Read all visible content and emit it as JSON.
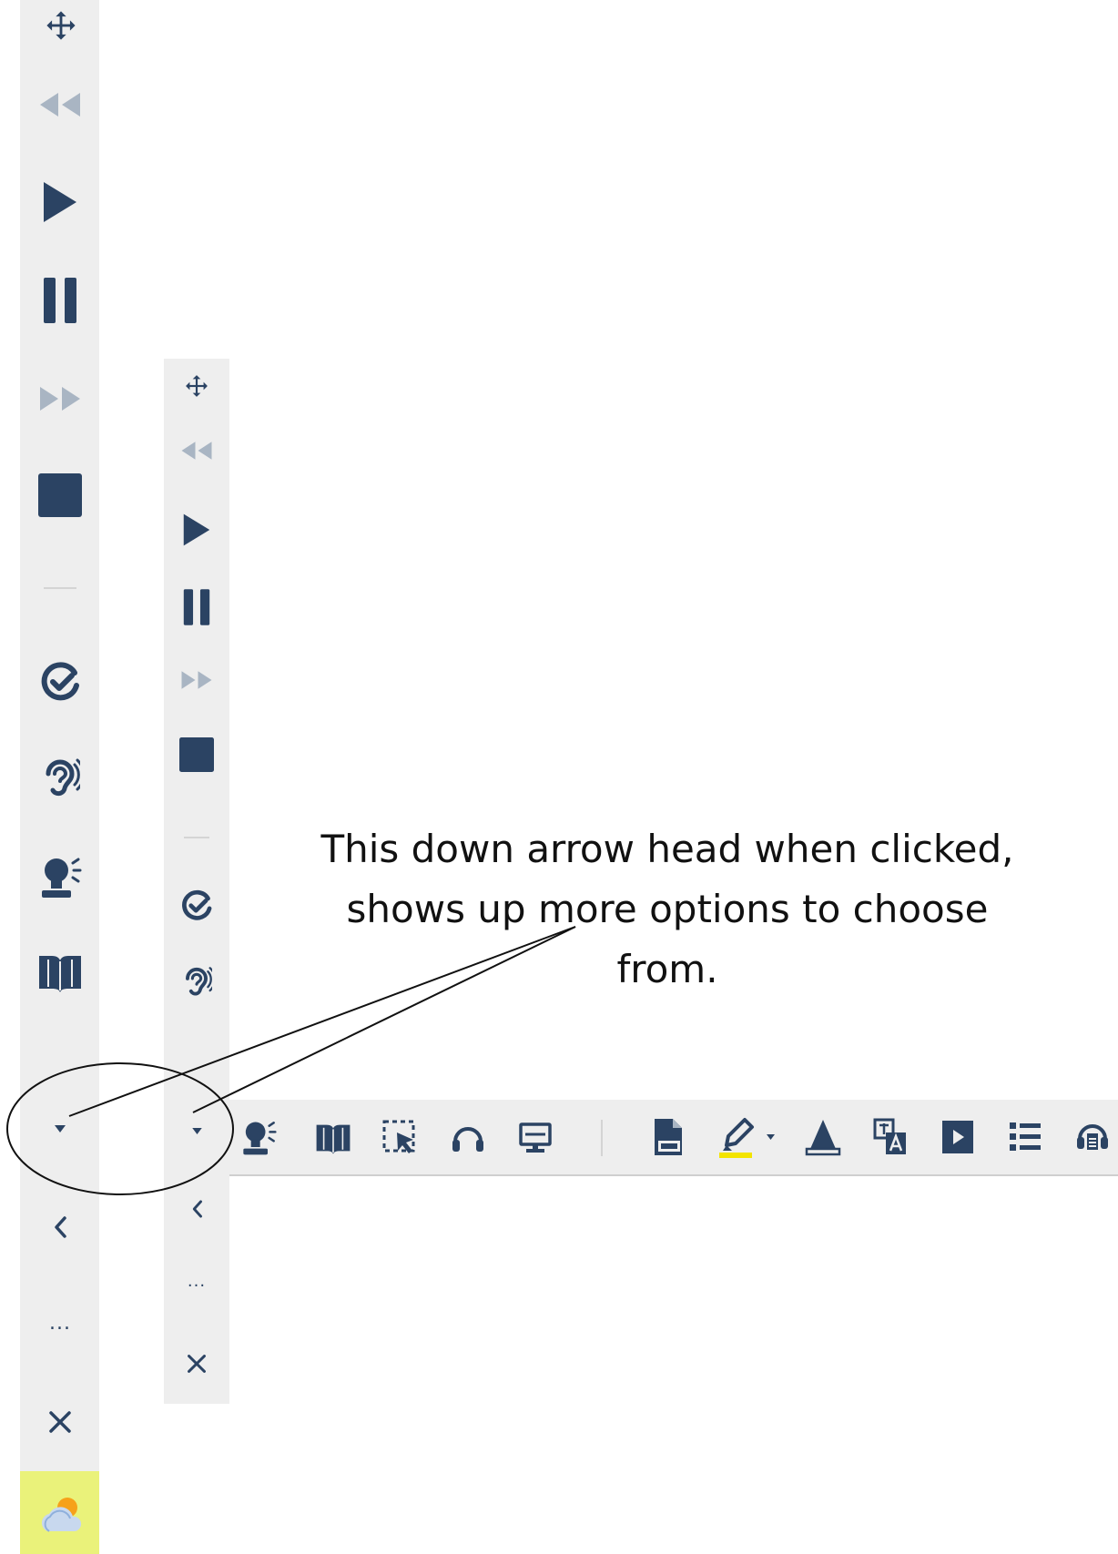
{
  "colors": {
    "icon_primary": "#2b4363",
    "icon_muted": "#a9b5c3",
    "toolbar_bg": "#eeeeee",
    "highlight_yellow": "#f3e400",
    "weather_tile_bg": "#eaf27a"
  },
  "toolbar_large": {
    "icons": [
      "move-icon",
      "rewind-icon",
      "play-icon",
      "pause-icon",
      "fast-forward-icon",
      "stop-icon",
      "check-icon",
      "hearing-icon",
      "voice-icon",
      "book-icon",
      "dropdown-arrow-icon",
      "collapse-chevron-icon",
      "more-icon",
      "close-icon",
      "weather-icon"
    ],
    "more_label": "...",
    "close_label": "×"
  },
  "toolbar_small": {
    "icons": [
      "move-icon",
      "rewind-icon",
      "play-icon",
      "pause-icon",
      "fast-forward-icon",
      "stop-icon",
      "check-icon",
      "hearing-icon",
      "dropdown-arrow-icon",
      "collapse-chevron-icon",
      "more-icon",
      "close-icon"
    ],
    "more_label": "...",
    "close_label": "×"
  },
  "toolbar_horizontal": {
    "icons": [
      "voice-icon",
      "book-icon",
      "screen-select-icon",
      "headphones-icon",
      "monitor-icon",
      "pdf-icon",
      "highlighter-icon",
      "highlighter-dropdown-icon",
      "text-mask-icon",
      "translate-icon",
      "video-icon",
      "list-icon",
      "audio-maker-icon"
    ]
  },
  "annotation": {
    "text": "This down arrow head when clicked,\nshows up more options to choose\nfrom."
  }
}
